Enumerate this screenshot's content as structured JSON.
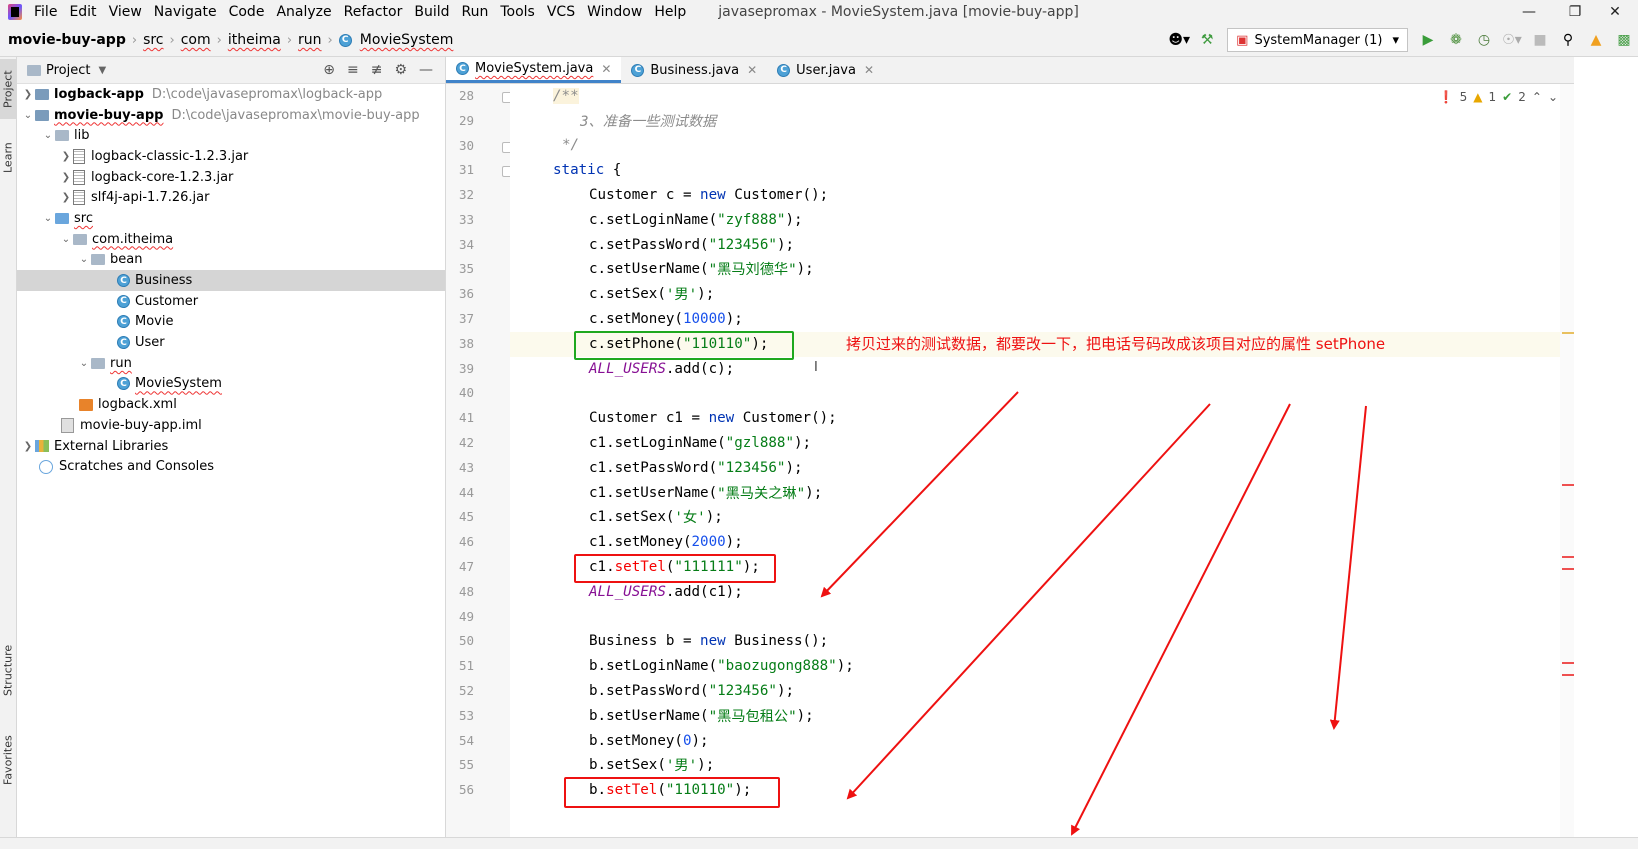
{
  "menu": [
    "File",
    "Edit",
    "View",
    "Navigate",
    "Code",
    "Analyze",
    "Refactor",
    "Build",
    "Run",
    "Tools",
    "VCS",
    "Window",
    "Help"
  ],
  "window_title": "javasepromax - MovieSystem.java [movie-buy-app]",
  "breadcrumbs": [
    "movie-buy-app",
    "src",
    "com",
    "itheima",
    "run",
    "MovieSystem"
  ],
  "run_config": "SystemManager (1)",
  "left_tabs": {
    "project": "Project",
    "learn": "Learn",
    "structure": "Structure",
    "favorites": "Favorites"
  },
  "project_panel": {
    "title": "Project"
  },
  "tree": [
    {
      "label": "logback-app",
      "hint": "D:\\code\\javasepromax\\logback-app"
    },
    {
      "label": "movie-buy-app",
      "hint": "D:\\code\\javasepromax\\movie-buy-app"
    },
    {
      "label": "lib"
    },
    {
      "label": "logback-classic-1.2.3.jar"
    },
    {
      "label": "logback-core-1.2.3.jar"
    },
    {
      "label": "slf4j-api-1.7.26.jar"
    },
    {
      "label": "src"
    },
    {
      "label": "com.itheima"
    },
    {
      "label": "bean"
    },
    {
      "label": "Business"
    },
    {
      "label": "Customer"
    },
    {
      "label": "Movie"
    },
    {
      "label": "User"
    },
    {
      "label": "run"
    },
    {
      "label": "MovieSystem"
    },
    {
      "label": "logback.xml"
    },
    {
      "label": "movie-buy-app.iml"
    },
    {
      "label": "External Libraries"
    },
    {
      "label": "Scratches and Consoles"
    }
  ],
  "editor_tabs": [
    "MovieSystem.java",
    "Business.java",
    "User.java"
  ],
  "inspections": {
    "errors": "5",
    "warnings": "1",
    "ok": "2"
  },
  "lines": {
    "n": [
      "28",
      "29",
      "30",
      "31",
      "32",
      "33",
      "34",
      "35",
      "36",
      "37",
      "38",
      "39",
      "40",
      "41",
      "42",
      "43",
      "44",
      "45",
      "46",
      "47",
      "48",
      "49",
      "50",
      "51",
      "52",
      "53",
      "54",
      "55",
      "56"
    ],
    "l28": "/**",
    "l29": "3、准备一些测试数据",
    "l30": "*/",
    "l31a": "static",
    "l31b": " {",
    "l32a": "Customer c = ",
    "l32b": "new",
    "l32c": " Customer();",
    "l33a": "c.setLoginName(",
    "l33b": "\"zyf888\"",
    "l33c": ");",
    "l34a": "c.setPassWord(",
    "l34b": "\"123456\"",
    "l34c": ");",
    "l35a": "c.setUserName(",
    "l35b": "\"黑马刘德华\"",
    "l35c": ");",
    "l36a": "c.setSex(",
    "l36b": "'男'",
    "l36c": ");",
    "l37a": "c.setMoney(",
    "l37b": "10000",
    "l37c": ");",
    "l38a": "c.setPhone(",
    "l38b": "\"110110\"",
    "l38c": ");",
    "l39a": "ALL_USERS",
    "l39b": ".add(c);",
    "l41a": "Customer c1 = ",
    "l41b": "new",
    "l41c": " Customer();",
    "l42a": "c1.setLoginName(",
    "l42b": "\"gzl888\"",
    "l42c": ");",
    "l43a": "c1.setPassWord(",
    "l43b": "\"123456\"",
    "l43c": ");",
    "l44a": "c1.setUserName(",
    "l44b": "\"黑马关之琳\"",
    "l44c": ");",
    "l45a": "c1.setSex(",
    "l45b": "'女'",
    "l45c": ");",
    "l46a": "c1.setMoney(",
    "l46b": "2000",
    "l46c": ");",
    "l47a": "c1.",
    "l47b": "setTel",
    "l47c": "(",
    "l47d": "\"111111\"",
    "l47e": ");",
    "l48a": "ALL_USERS",
    "l48b": ".add(c1);",
    "l50a": "Business b = ",
    "l50b": "new",
    "l50c": " Business();",
    "l51a": "b.setLoginName(",
    "l51b": "\"baozugong888\"",
    "l51c": ");",
    "l52a": "b.setPassWord(",
    "l52b": "\"123456\"",
    "l52c": ");",
    "l53a": "b.setUserName(",
    "l53b": "\"黑马包租公\"",
    "l53c": ");",
    "l54a": "b.setMoney(",
    "l54b": "0",
    "l54c": ");",
    "l55a": "b.setSex(",
    "l55b": "'男'",
    "l55c": ");",
    "l56a": "b.",
    "l56b": "setTel",
    "l56c": "(",
    "l56d": "\"110110\"",
    "l56e": ");"
  },
  "annotation": "拷贝过来的测试数据，都要改一下，把电话号码改成该项目对应的属性 setPhone",
  "colors": {
    "annotation": "#ee1111",
    "highlight_box": "#1fa81f",
    "keyword": "#0033b3",
    "string": "#067d17",
    "number": "#1750eb"
  }
}
